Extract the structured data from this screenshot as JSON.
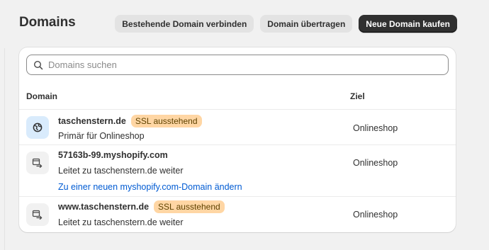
{
  "header": {
    "title": "Domains",
    "buttons": {
      "connect": "Bestehende Domain verbinden",
      "transfer": "Domain übertragen",
      "buy": "Neue Domain kaufen"
    }
  },
  "search": {
    "placeholder": "Domains suchen",
    "value": ""
  },
  "table": {
    "columns": {
      "domain": "Domain",
      "target": "Ziel"
    },
    "rows": [
      {
        "domain": "taschenstern.de",
        "badge": "SSL ausstehend",
        "description": "Primär für Onlineshop",
        "target": "Onlineshop",
        "icon": "globe-icon"
      },
      {
        "domain": "57163b-99.myshopify.com",
        "description": "Leitet zu taschenstern.de weiter",
        "link": "Zu einer neuen myshopify.com-Domain ändern",
        "target": "Onlineshop",
        "icon": "redirect-icon"
      },
      {
        "domain": "www.taschenstern.de",
        "badge": "SSL ausstehend",
        "description": "Leitet zu taschenstern.de weiter",
        "target": "Onlineshop",
        "icon": "redirect-icon"
      }
    ]
  },
  "colors": {
    "background": "#f1f1f1",
    "primary_button": "#303030",
    "badge_warning": "#ffd6a4",
    "link": "#005bd3",
    "primary_icon_bg": "#d9ebfc"
  }
}
